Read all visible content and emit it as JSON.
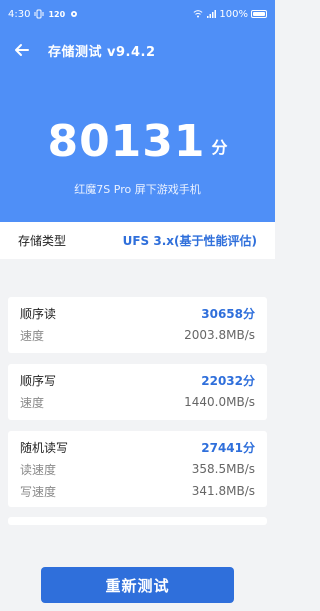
{
  "status_bar": {
    "time": "4:30",
    "indicator": "120",
    "battery": "100%"
  },
  "app_bar": {
    "title": "存储测试 v9.4.2"
  },
  "hero": {
    "score": "80131",
    "score_unit": "分",
    "device": "红魔7S Pro 屏下游戏手机"
  },
  "storage_type": {
    "label": "存储类型",
    "value": "UFS 3.x(基于性能评估)"
  },
  "sequential_read": {
    "title": "顺序读",
    "score": "30658分",
    "speed_label": "速度",
    "speed_value": "2003.8MB/s"
  },
  "sequential_write": {
    "title": "顺序写",
    "score": "22032分",
    "speed_label": "速度",
    "speed_value": "1440.0MB/s"
  },
  "random_rw": {
    "title": "随机读写",
    "score": "27441分",
    "read_label": "读速度",
    "read_value": "358.5MB/s",
    "write_label": "写速度",
    "write_value": "341.8MB/s"
  },
  "actions": {
    "retest_label": "重新测试"
  },
  "colors": {
    "hero_blue": "#4f8ff7",
    "accent_blue": "#2f6fdb",
    "background": "#f2f3f5"
  }
}
